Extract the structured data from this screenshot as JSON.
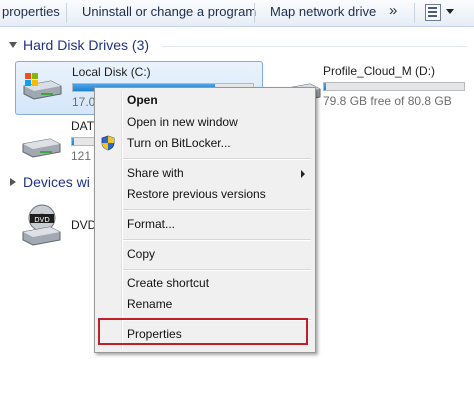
{
  "toolbar": {
    "properties": "properties",
    "uninstall": "Uninstall or change a program",
    "map_drive": "Map network drive",
    "more": "»"
  },
  "groups": {
    "hard_disk": "Hard Disk Drives (3)",
    "devices": "Devices wi"
  },
  "drives": {
    "local_c": {
      "name": "Local Disk (C:)",
      "free": "17.0",
      "used_fraction": 0.79
    },
    "profile_d": {
      "name": "Profile_Cloud_M (D:)",
      "free": "79.8 GB free of 80.8 GB",
      "used_fraction": 0.013
    },
    "data": {
      "name": "DAT",
      "free": "121",
      "used_fraction": 0.05
    },
    "dvd": {
      "name": "DVD"
    }
  },
  "context_menu": {
    "open": "Open",
    "open_new_window": "Open in new window",
    "bitlocker": "Turn on BitLocker...",
    "share_with": "Share with",
    "restore_previous": "Restore previous versions",
    "format": "Format...",
    "copy": "Copy",
    "create_shortcut": "Create shortcut",
    "rename": "Rename",
    "properties": "Properties"
  },
  "colors": {
    "group_header": "#1e3287",
    "selection_fill": "#d4e6fa",
    "highlight_box": "#c0202a",
    "bar_fill": "#1f83cf"
  }
}
